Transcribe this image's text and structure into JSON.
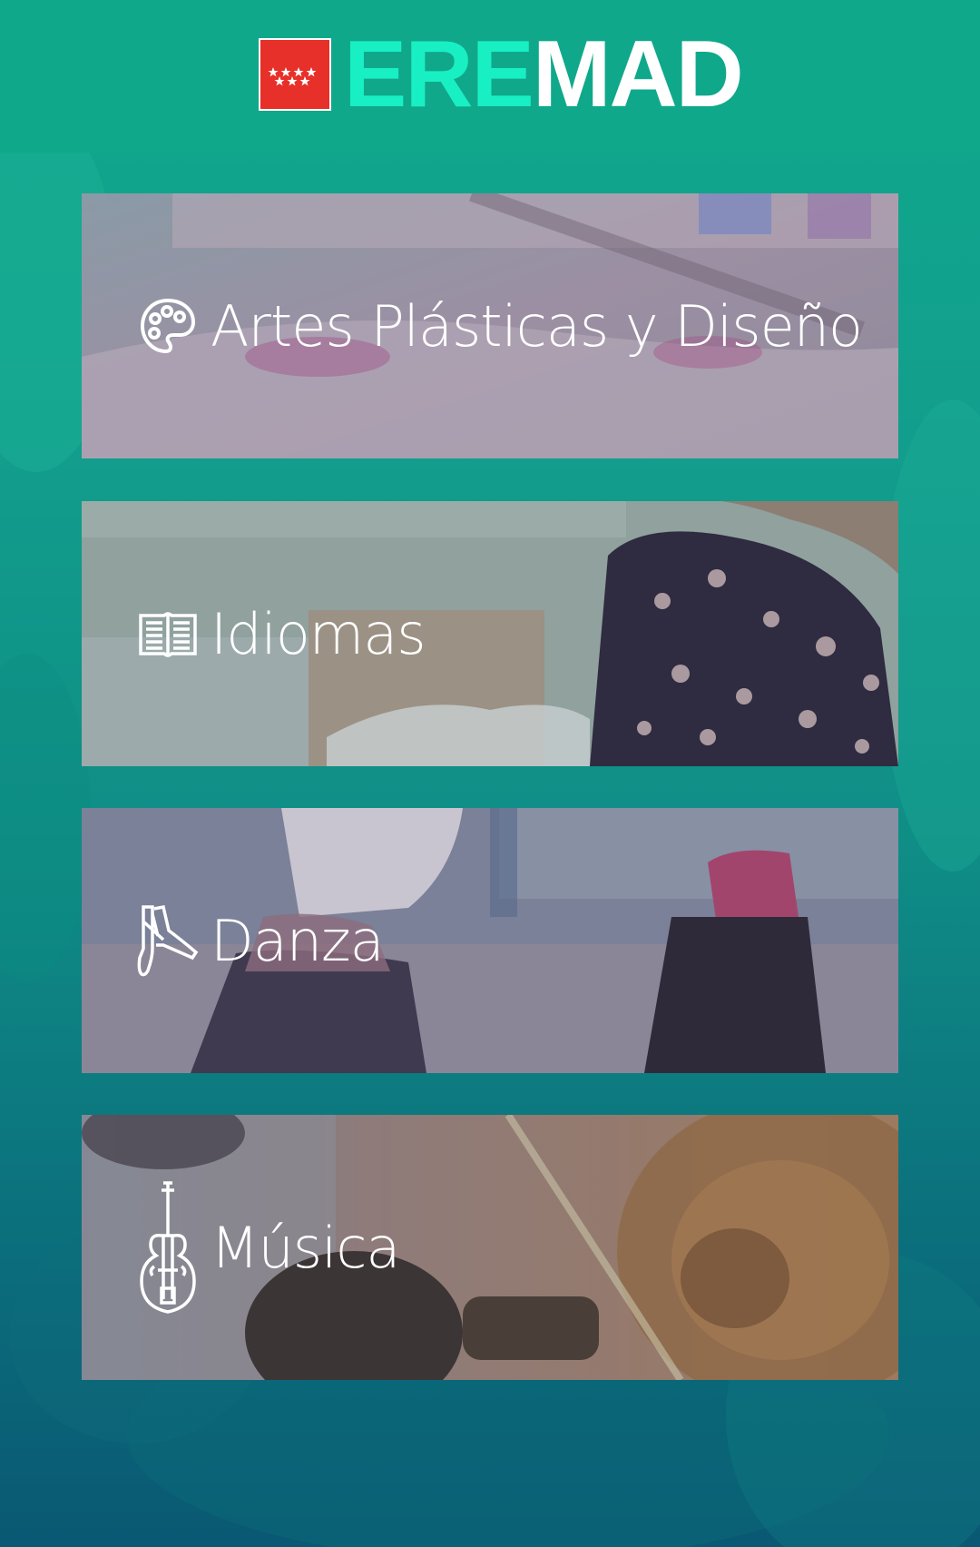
{
  "header": {
    "logo_text_colored": "ERE",
    "logo_text_white": "MAD",
    "flag_icon": "madrid-flag-icon",
    "colors": {
      "teal": "#10a88b",
      "logo_accent": "#18f0c4",
      "flag_red": "#e7302a"
    }
  },
  "categories": [
    {
      "label": "Artes Plásticas y Diseño",
      "icon": "palette-icon"
    },
    {
      "label": "Idiomas",
      "icon": "book-icon"
    },
    {
      "label": "Danza",
      "icon": "ballet-shoes-icon"
    },
    {
      "label": "Música",
      "icon": "violin-icon"
    }
  ]
}
